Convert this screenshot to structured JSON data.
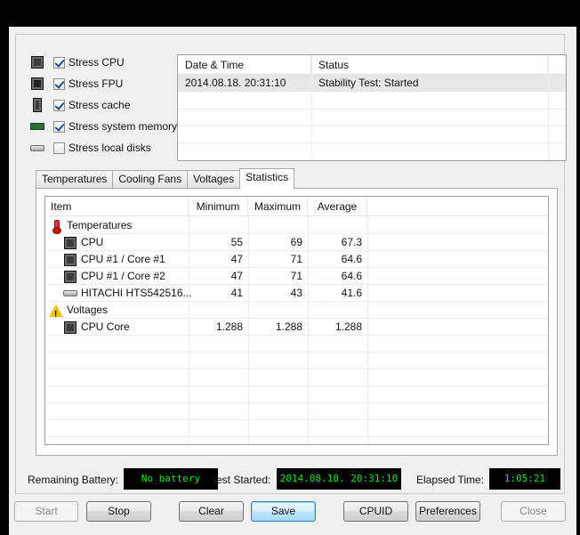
{
  "stress_options": [
    {
      "label": "Stress CPU",
      "checked": true,
      "icon": "cpu-chip-icon"
    },
    {
      "label": "Stress FPU",
      "checked": true,
      "icon": "fpu-chip-icon"
    },
    {
      "label": "Stress cache",
      "checked": true,
      "icon": "cache-chip-icon"
    },
    {
      "label": "Stress system memory",
      "checked": true,
      "icon": "memory-module-icon"
    },
    {
      "label": "Stress local disks",
      "checked": false,
      "icon": "hard-disk-icon"
    }
  ],
  "log": {
    "columns": [
      "Date & Time",
      "Status"
    ],
    "rows": [
      {
        "datetime": "2014.08.18. 20:31:10",
        "status": "Stability Test: Started"
      }
    ]
  },
  "tabs": [
    "Temperatures",
    "Cooling Fans",
    "Voltages",
    "Statistics"
  ],
  "active_tab": "Statistics",
  "statistics": {
    "columns": [
      "Item",
      "Minimum",
      "Maximum",
      "Average"
    ],
    "rows": [
      {
        "type": "group",
        "name": "Temperatures",
        "icon": "thermometer-icon"
      },
      {
        "type": "item",
        "name": "CPU",
        "min": "55",
        "max": "69",
        "avg": "67.3",
        "icon": "cpu-chip-icon"
      },
      {
        "type": "item",
        "name": "CPU #1 / Core #1",
        "min": "47",
        "max": "71",
        "avg": "64.6",
        "icon": "cpu-chip-icon"
      },
      {
        "type": "item",
        "name": "CPU #1 / Core #2",
        "min": "47",
        "max": "71",
        "avg": "64.6",
        "icon": "cpu-chip-icon"
      },
      {
        "type": "item",
        "name": "HITACHI HTS542516...",
        "min": "41",
        "max": "43",
        "avg": "41.6",
        "icon": "hard-disk-icon"
      },
      {
        "type": "group",
        "name": "Voltages",
        "icon": "warning-icon"
      },
      {
        "type": "item",
        "name": "CPU Core",
        "min": "1.288",
        "max": "1.288",
        "avg": "1.288",
        "icon": "cpu-chip-icon"
      }
    ]
  },
  "status_bar": {
    "battery_label": "Remaining Battery:",
    "battery_value": "No battery",
    "started_label": "Test Started:",
    "started_value": "2014.08.18. 20:31:10",
    "elapsed_label": "Elapsed Time:",
    "elapsed_value": "1:05:21",
    "lcd_text_color": "#19e619"
  },
  "buttons": {
    "start": "Start",
    "stop": "Stop",
    "clear": "Clear",
    "save": "Save",
    "cpuid": "CPUID",
    "preferences": "Preferences",
    "close": "Close"
  }
}
